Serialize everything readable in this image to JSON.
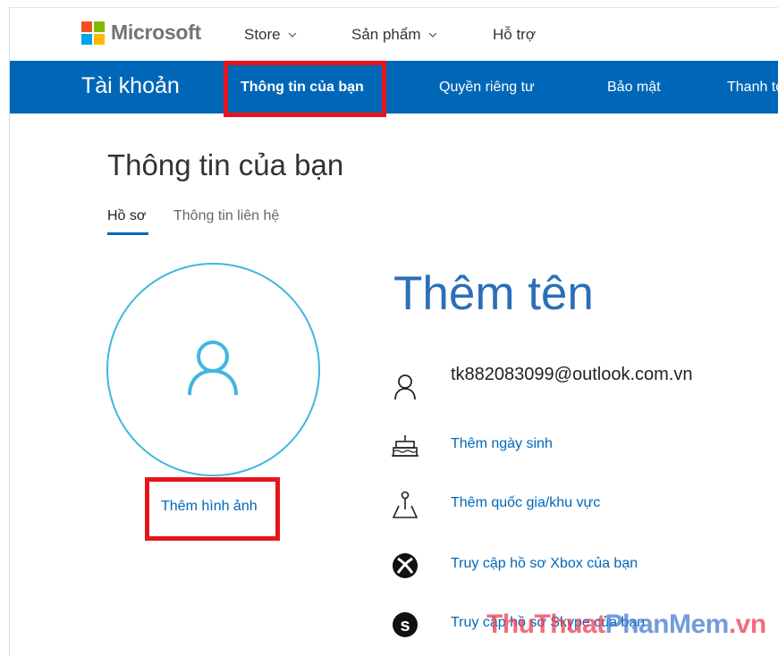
{
  "brand": {
    "name": "Microsoft",
    "logo_colors": [
      "#f25022",
      "#7fba00",
      "#00a4ef",
      "#ffb900"
    ]
  },
  "topnav": {
    "items": [
      {
        "label": "Store",
        "has_dropdown": true
      },
      {
        "label": "Sản phẩm",
        "has_dropdown": true
      },
      {
        "label": "Hỗ trợ",
        "has_dropdown": false
      }
    ]
  },
  "account_bar": {
    "title": "Tài khoản",
    "tabs": [
      {
        "label": "Thông tin của bạn",
        "active": true
      },
      {
        "label": "Quyền riêng tư",
        "active": false
      },
      {
        "label": "Bảo mật",
        "active": false
      },
      {
        "label": "Thanh toán",
        "active": false
      }
    ],
    "color": "#0067b8"
  },
  "page": {
    "title": "Thông tin của bạn",
    "subtabs": [
      {
        "label": "Hồ sơ",
        "active": true
      },
      {
        "label": "Thông tin liên hệ",
        "active": false
      }
    ]
  },
  "profile": {
    "add_photo_label": "Thêm hình ảnh",
    "add_name_label": "Thêm tên",
    "email": "tk882083099@outlook.com.vn",
    "links": [
      {
        "icon": "birthday-cake-icon",
        "label": "Thêm ngày sinh"
      },
      {
        "icon": "location-pin-icon",
        "label": "Thêm quốc gia/khu vực"
      },
      {
        "icon": "xbox-icon",
        "label": "Truy cập hồ sơ Xbox của bạn"
      },
      {
        "icon": "skype-icon",
        "label": "Truy cập hồ sơ Skype của bạn"
      }
    ]
  },
  "highlight_color": "#e8141b",
  "watermark": {
    "part1": "ThuThuat",
    "part2": "PhanMem",
    "part3": ".vn"
  }
}
